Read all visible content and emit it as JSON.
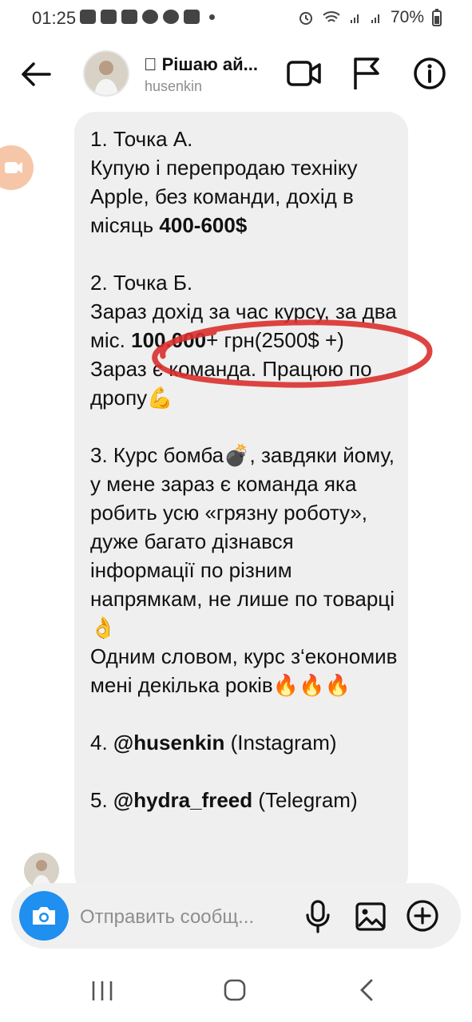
{
  "status_bar": {
    "time": "01:25",
    "battery": "70%",
    "icons": [
      "youtube-icon",
      "youtube-icon",
      "youtube-icon",
      "telegram-icon",
      "telegram-icon",
      "instagram-icon",
      "dot-icon",
      "alarm-icon",
      "wifi-icon",
      "signal-icon",
      "signal-icon",
      "battery-icon"
    ]
  },
  "header": {
    "title": "\u0000 Рішаю ай...",
    "username": "husenkin"
  },
  "message": {
    "p1_line1": "1. Точка А.",
    "p1_line2": "Купую і перепродаю техніку Apple, без команди, дохід в місяць ",
    "p1_bold": "400-600$",
    "p2_line1": "2. Точка Б.",
    "p2_line2": "Зараз дохід за час курсу, за два міс. ",
    "p2_bold": "100.000",
    "p2_rest": "+ грн(2500$ +)",
    "p2_line3": "Зараз є команда. Працюю по дропу💪",
    "p3_line1": "3. Курс бомба💣, завдяки йому, у мене зараз є команда яка робить усю «грязну роботу», дуже багато дізнався інформації по різним напрямкам, не лише по товарці👌",
    "p3_line2": "Одним словом, курс з‘економив мені декілька років🔥🔥🔥",
    "p4_prefix": "4. ",
    "p4_handle": "@husenkin",
    "p4_suffix": " (Instagram)",
    "p5_prefix": "5. ",
    "p5_handle": "@hydra_freed",
    "p5_suffix": " (Telegram)"
  },
  "composer": {
    "placeholder": "Отправить сообщ..."
  },
  "colors": {
    "accent": "#1f8ff0",
    "bubble": "#efefef",
    "annotation": "#d9302c"
  }
}
